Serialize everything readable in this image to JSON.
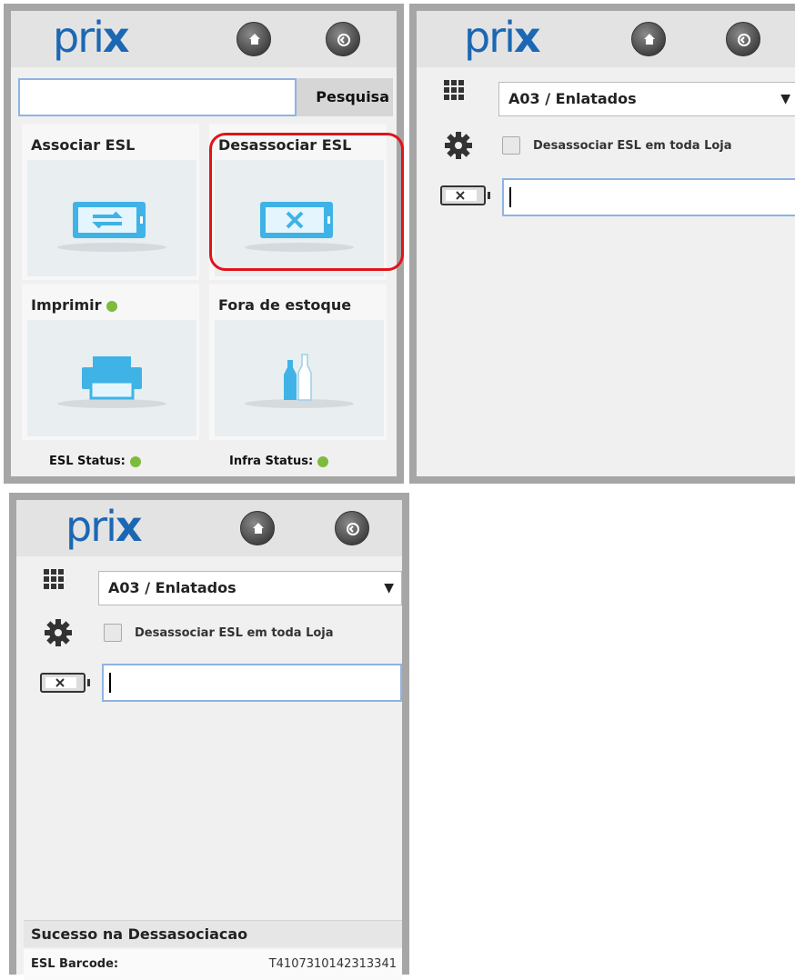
{
  "app": {
    "logo": {
      "text_main": "pri",
      "text_x": "x"
    },
    "brand_color": "#1b67b4",
    "status_green": "#7dbb3c",
    "highlight_color": "#e0141b"
  },
  "panel1": {
    "search": {
      "value": "",
      "placeholder": "",
      "button_label": "Pesquisa"
    },
    "tiles": [
      {
        "label": "Associar ESL",
        "icon": "esl-associate-icon"
      },
      {
        "label": "Desassociar ESL",
        "icon": "esl-disassociate-icon",
        "highlighted": true
      },
      {
        "label": "Imprimir",
        "icon": "printer-icon",
        "status_dot": true
      },
      {
        "label": "Fora de estoque",
        "icon": "bottles-icon"
      }
    ],
    "status": {
      "esl_label": "ESL Status:",
      "infra_label": "Infra Status:"
    }
  },
  "panel2": {
    "aisle_select": {
      "value": "A03 / Enlatados"
    },
    "store_wide_checkbox": {
      "label": "Desassociar ESL em toda Loja",
      "checked": false
    },
    "barcode_input": {
      "value": ""
    }
  },
  "panel3": {
    "aisle_select": {
      "value": "A03 / Enlatados"
    },
    "store_wide_checkbox": {
      "label": "Desassociar ESL em toda Loja",
      "checked": false
    },
    "barcode_input": {
      "value": ""
    },
    "result": {
      "title": "Sucesso na Dessasociacao",
      "barcode_label": "ESL Barcode:",
      "barcode_value": "T4107310142313341"
    }
  }
}
